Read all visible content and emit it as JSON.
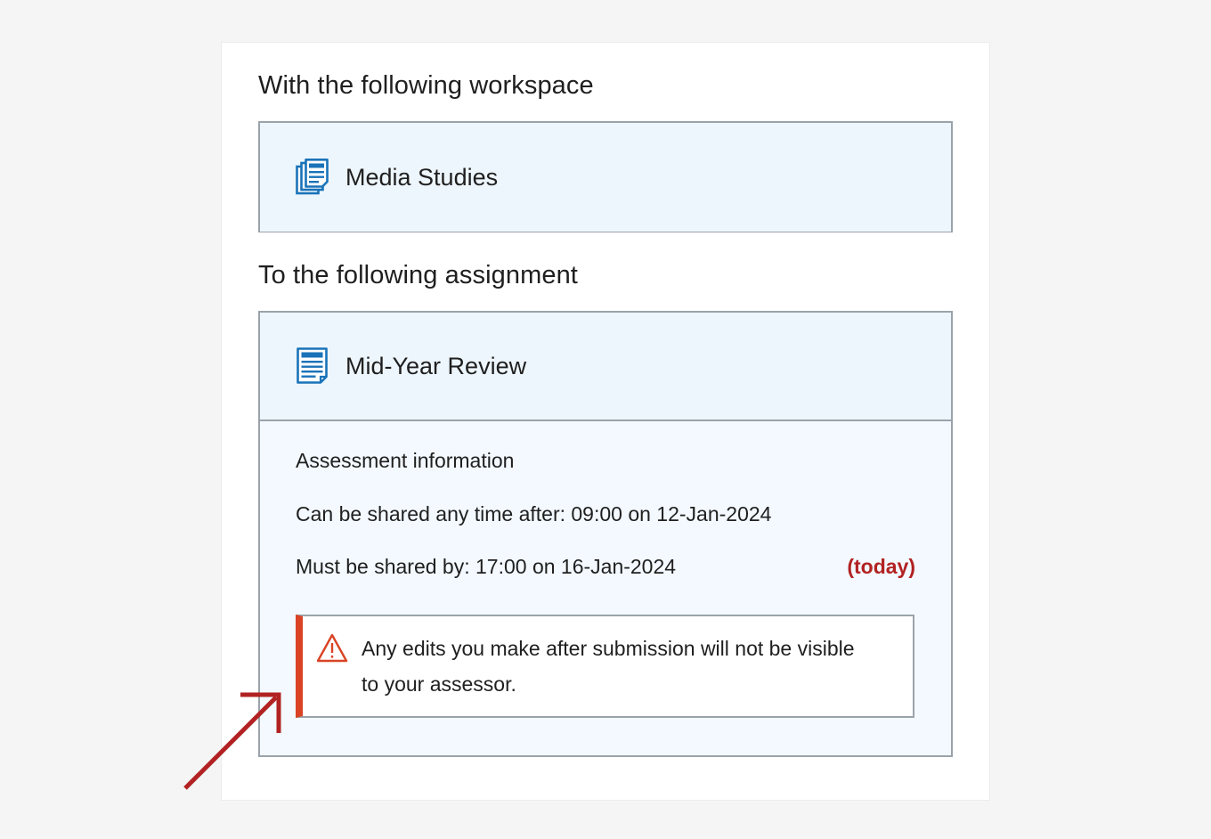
{
  "workspace": {
    "heading": "With the following workspace",
    "name": "Media Studies",
    "icon": "workspace-documents-icon"
  },
  "assignment": {
    "heading": "To the following assignment",
    "name": "Mid-Year Review",
    "icon": "assignment-document-icon",
    "assessment": {
      "title": "Assessment information",
      "shared_after": "Can be shared any time after: 09:00 on 12-Jan-2024",
      "shared_by": "Must be shared by: 17:00 on 16-Jan-2024",
      "today_label": "(today)"
    },
    "warning": {
      "icon": "warning-triangle-icon",
      "text": "Any edits you make after submission will not be visible to your assessor."
    }
  },
  "colors": {
    "accent_blue": "#1a73b8",
    "warning_red": "#d94324",
    "today_red": "#b22222",
    "arrow_red": "#b22222",
    "box_fill": "#eef6fd",
    "border_grey": "#9aa3ab"
  }
}
